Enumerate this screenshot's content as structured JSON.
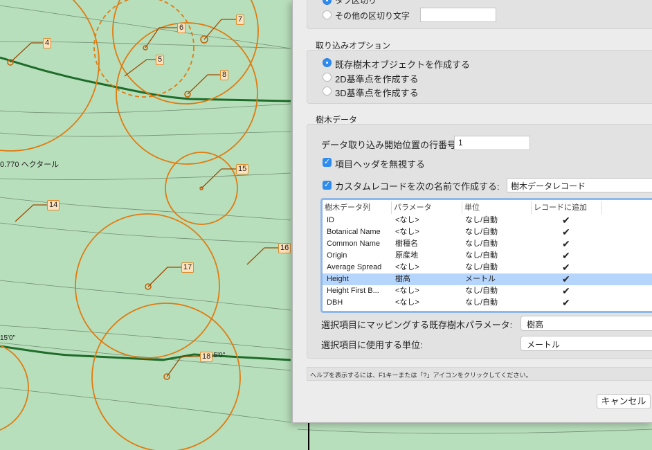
{
  "map": {
    "area_label": "0.770 ヘクタール",
    "contour_labels": [
      "15'0\"",
      "15'0\""
    ],
    "trees": [
      {
        "id": "4"
      },
      {
        "id": "5"
      },
      {
        "id": "6"
      },
      {
        "id": "7"
      },
      {
        "id": "8"
      },
      {
        "id": "14"
      },
      {
        "id": "15"
      },
      {
        "id": "16"
      },
      {
        "id": "17"
      },
      {
        "id": "18"
      }
    ]
  },
  "dialog": {
    "delimiter": {
      "partial_top_option": "タブ区切り",
      "other_option": "その他の区切り文字",
      "other_value": ""
    },
    "import_options": {
      "title": "取り込みオプション",
      "options": [
        "既存樹木オブジェクトを作成する",
        "2D基準点を作成する",
        "3D基準点を作成する"
      ],
      "selected": 0
    },
    "tree_data": {
      "title": "樹木データ",
      "start_row_label": "データ取り込み開始位置の行番号",
      "start_row_value": "1",
      "ignore_header_label": "項目ヘッダを無視する",
      "ignore_header_checked": true,
      "custom_record_label": "カスタムレコードを次の名前で作成する:",
      "custom_record_checked": true,
      "custom_record_value": "樹木データレコード",
      "table": {
        "headers": [
          "樹木データ列",
          "パラメータ",
          "単位",
          "レコードに追加"
        ],
        "rows": [
          {
            "column": "ID",
            "param": "<なし>",
            "unit": "なし/自動",
            "add": "✔"
          },
          {
            "column": "Botanical Name",
            "param": "<なし>",
            "unit": "なし/自動",
            "add": "✔"
          },
          {
            "column": "Common Name",
            "param": "樹種名",
            "unit": "なし/自動",
            "add": "✔"
          },
          {
            "column": "Origin",
            "param": "原産地",
            "unit": "なし/自動",
            "add": "✔"
          },
          {
            "column": "Average Spread",
            "param": "<なし>",
            "unit": "なし/自動",
            "add": "✔"
          },
          {
            "column": "Height",
            "param": "樹高",
            "unit": "メートル",
            "add": "✔"
          },
          {
            "column": "Height First B...",
            "param": "<なし>",
            "unit": "なし/自動",
            "add": "✔"
          },
          {
            "column": "DBH",
            "param": "<なし>",
            "unit": "なし/自動",
            "add": "✔"
          }
        ],
        "selected_row": 5
      },
      "mapping_label": "選択項目にマッピングする既存樹木パラメータ:",
      "mapping_value": "樹高",
      "unit_label": "選択項目に使用する単位:",
      "unit_value": "メートル"
    },
    "help_text": "ヘルプを表示するには、F1キーまたは「?」アイコンをクリックしてください。",
    "cancel_button": "キャンセル"
  },
  "colors": {
    "map_bg": "#b8dfbb",
    "canopy": "#e07b10",
    "road": "#1e6b2a",
    "accent": "#2e8cf0",
    "selected_row": "#b5d5fd"
  }
}
